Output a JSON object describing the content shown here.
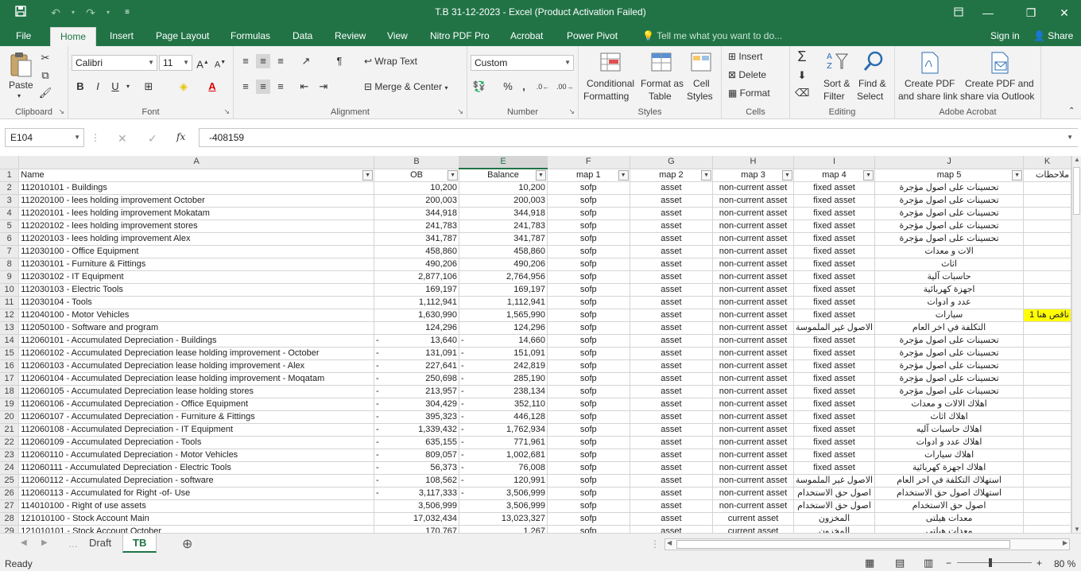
{
  "window": {
    "title": "T.B 31-12-2023 - Excel (Product Activation Failed)"
  },
  "ribbon_tabs": [
    "File",
    "Home",
    "Insert",
    "Page Layout",
    "Formulas",
    "Data",
    "Review",
    "View",
    "Nitro PDF Pro",
    "Acrobat",
    "Power Pivot"
  ],
  "tell_me": "Tell me what you want to do...",
  "account": {
    "signin": "Sign in",
    "share": "Share"
  },
  "ribbon": {
    "clipboard": {
      "paste": "Paste",
      "label": "Clipboard"
    },
    "font": {
      "name": "Calibri",
      "size": "11",
      "label": "Font",
      "bold": "B",
      "italic": "I",
      "underline": "U"
    },
    "alignment": {
      "wrap": "Wrap Text",
      "merge": "Merge & Center",
      "label": "Alignment"
    },
    "number": {
      "format": "Custom",
      "label": "Number"
    },
    "styles": {
      "conditional_1": "Conditional",
      "conditional_2": "Formatting",
      "format_table_1": "Format as",
      "format_table_2": "Table",
      "cell_styles_1": "Cell",
      "cell_styles_2": "Styles",
      "label": "Styles"
    },
    "cells": {
      "insert": "Insert",
      "delete": "Delete",
      "format": "Format",
      "label": "Cells"
    },
    "editing": {
      "sort_1": "Sort &",
      "sort_2": "Filter",
      "find_1": "Find &",
      "find_2": "Select",
      "label": "Editing"
    },
    "acrobat": {
      "create_1": "Create PDF",
      "create_2": "and share link",
      "outlook_1": "Create PDF and",
      "outlook_2": "share via Outlook",
      "label": "Adobe Acrobat"
    }
  },
  "formula_bar": {
    "name_box": "E104",
    "fx": "fx",
    "value": "-408159"
  },
  "columns": [
    "A",
    "B",
    "E",
    "F",
    "G",
    "H",
    "I",
    "J",
    "K"
  ],
  "headers": [
    "Name",
    "OB",
    "Balance",
    "map 1",
    "map 2",
    "map 3",
    "map 4",
    "map 5",
    "ملاحظات"
  ],
  "rows": [
    {
      "n": "2",
      "name": "112010101 - Buildings",
      "ob": "10,200",
      "bal": "10,200",
      "m1": "sofp",
      "m2": "asset",
      "m3": "non-current asset",
      "m4": "fixed asset",
      "m5": "تحسينات على اصول مؤجرة",
      "note": ""
    },
    {
      "n": "3",
      "name": "112020100 - lees holding improvement October",
      "ob": "200,003",
      "bal": "200,003",
      "m1": "sofp",
      "m2": "asset",
      "m3": "non-current asset",
      "m4": "fixed asset",
      "m5": "تحسينات على اصول مؤجرة",
      "note": ""
    },
    {
      "n": "4",
      "name": "112020101 - lees holding improvement Mokatam",
      "ob": "344,918",
      "bal": "344,918",
      "m1": "sofp",
      "m2": "asset",
      "m3": "non-current asset",
      "m4": "fixed asset",
      "m5": "تحسينات على اصول مؤجرة",
      "note": ""
    },
    {
      "n": "5",
      "name": "112020102 - lees holding improvement stores",
      "ob": "241,783",
      "bal": "241,783",
      "m1": "sofp",
      "m2": "asset",
      "m3": "non-current asset",
      "m4": "fixed asset",
      "m5": "تحسينات على اصول مؤجرة",
      "note": ""
    },
    {
      "n": "6",
      "name": "112020103 - lees holding improvement Alex",
      "ob": "341,787",
      "bal": "341,787",
      "m1": "sofp",
      "m2": "asset",
      "m3": "non-current asset",
      "m4": "fixed asset",
      "m5": "تحسينات على اصول مؤجرة",
      "note": ""
    },
    {
      "n": "7",
      "name": "112030100 - Office Equipment",
      "ob": "458,860",
      "bal": "458,860",
      "m1": "sofp",
      "m2": "asset",
      "m3": "non-current asset",
      "m4": "fixed asset",
      "m5": "الات و معدات",
      "note": ""
    },
    {
      "n": "8",
      "name": "112030101 - Furniture & Fittings",
      "ob": "490,206",
      "bal": "490,206",
      "m1": "sofp",
      "m2": "asset",
      "m3": "non-current asset",
      "m4": "fixed asset",
      "m5": "اثاث",
      "note": ""
    },
    {
      "n": "9",
      "name": "112030102 - IT Equipment",
      "ob": "2,877,106",
      "bal": "2,764,956",
      "m1": "sofp",
      "m2": "asset",
      "m3": "non-current asset",
      "m4": "fixed asset",
      "m5": "حاسبات آلية",
      "note": ""
    },
    {
      "n": "10",
      "name": "112030103 - Electric Tools",
      "ob": "169,197",
      "bal": "169,197",
      "m1": "sofp",
      "m2": "asset",
      "m3": "non-current asset",
      "m4": "fixed asset",
      "m5": "اجهزة كهربائية",
      "note": ""
    },
    {
      "n": "11",
      "name": "112030104 - Tools",
      "ob": "1,112,941",
      "bal": "1,112,941",
      "m1": "sofp",
      "m2": "asset",
      "m3": "non-current asset",
      "m4": "fixed asset",
      "m5": "عدد و ادوات",
      "note": ""
    },
    {
      "n": "12",
      "name": "112040100 - Motor Vehicles",
      "ob": "1,630,990",
      "bal": "1,565,990",
      "m1": "sofp",
      "m2": "asset",
      "m3": "non-current asset",
      "m4": "fixed asset",
      "m5": "سيارات",
      "note": "ناقص هنا 1"
    },
    {
      "n": "13",
      "name": "112050100 - Software and program",
      "ob": "124,296",
      "bal": "124,296",
      "m1": "sofp",
      "m2": "asset",
      "m3": "non-current asset",
      "m4": "الاصول غير الملموسة",
      "m5": "التكلفة في اخر العام",
      "note": ""
    },
    {
      "n": "14",
      "name": "112060101 - Accumulated Depreciation - Buildings",
      "ob": "13,640",
      "bal": "14,660",
      "neg": true,
      "m1": "sofp",
      "m2": "asset",
      "m3": "non-current asset",
      "m4": "fixed asset",
      "m5": "تحسينات على اصول مؤجرة",
      "note": ""
    },
    {
      "n": "15",
      "name": "112060102 - Accumulated Depreciation lease holding improvement - October",
      "ob": "131,091",
      "bal": "151,091",
      "neg": true,
      "m1": "sofp",
      "m2": "asset",
      "m3": "non-current asset",
      "m4": "fixed asset",
      "m5": "تحسينات على اصول مؤجرة",
      "note": ""
    },
    {
      "n": "16",
      "name": "112060103 - Accumulated Depreciation lease holding improvement - Alex",
      "ob": "227,641",
      "bal": "242,819",
      "neg": true,
      "m1": "sofp",
      "m2": "asset",
      "m3": "non-current asset",
      "m4": "fixed asset",
      "m5": "تحسينات على اصول مؤجرة",
      "note": ""
    },
    {
      "n": "17",
      "name": "112060104 - Accumulated Depreciation lease holding improvement - Moqatam",
      "ob": "250,698",
      "bal": "285,190",
      "neg": true,
      "m1": "sofp",
      "m2": "asset",
      "m3": "non-current asset",
      "m4": "fixed asset",
      "m5": "تحسينات على اصول مؤجرة",
      "note": ""
    },
    {
      "n": "18",
      "name": "112060105 - Accumulated Depreciation lease holding stores",
      "ob": "213,957",
      "bal": "238,134",
      "neg": true,
      "m1": "sofp",
      "m2": "asset",
      "m3": "non-current asset",
      "m4": "fixed asset",
      "m5": "تحسينات على اصول مؤجرة",
      "note": ""
    },
    {
      "n": "19",
      "name": "112060106 - Accumulated Depreciation - Office Equipment",
      "ob": "304,429",
      "bal": "352,110",
      "neg": true,
      "m1": "sofp",
      "m2": "asset",
      "m3": "non-current asset",
      "m4": "fixed asset",
      "m5": "اهلاك الالات و معدات",
      "note": ""
    },
    {
      "n": "20",
      "name": "112060107 - Accumulated Depreciation - Furniture & Fittings",
      "ob": "395,323",
      "bal": "446,128",
      "neg": true,
      "m1": "sofp",
      "m2": "asset",
      "m3": "non-current asset",
      "m4": "fixed asset",
      "m5": "اهلاك اثاث",
      "note": ""
    },
    {
      "n": "21",
      "name": "112060108 - Accumulated Depreciation - IT Equipment",
      "ob": "1,339,432",
      "bal": "1,762,934",
      "neg": true,
      "m1": "sofp",
      "m2": "asset",
      "m3": "non-current asset",
      "m4": "fixed asset",
      "m5": "اهلاك حاسبات آليه",
      "note": ""
    },
    {
      "n": "22",
      "name": "112060109 - Accumulated Depreciation - Tools",
      "ob": "635,155",
      "bal": "771,961",
      "neg": true,
      "m1": "sofp",
      "m2": "asset",
      "m3": "non-current asset",
      "m4": "fixed asset",
      "m5": "اهلاك عدد و ادوات",
      "note": ""
    },
    {
      "n": "23",
      "name": "112060110 - Accumulated Depreciation - Motor Vehicles",
      "ob": "809,057",
      "bal": "1,002,681",
      "neg": true,
      "m1": "sofp",
      "m2": "asset",
      "m3": "non-current asset",
      "m4": "fixed asset",
      "m5": "اهلاك سيارات",
      "note": ""
    },
    {
      "n": "24",
      "name": "112060111 - Accumulated Depreciation - Electric Tools",
      "ob": "56,373",
      "bal": "76,008",
      "neg": true,
      "m1": "sofp",
      "m2": "asset",
      "m3": "non-current asset",
      "m4": "fixed asset",
      "m5": "اهلاك اجهزة كهربائية",
      "note": ""
    },
    {
      "n": "25",
      "name": "112060112 - Accumulated Depreciation - software",
      "ob": "108,562",
      "bal": "120,991",
      "neg": true,
      "m1": "sofp",
      "m2": "asset",
      "m3": "non-current asset",
      "m4": "الاصول غير الملموسة",
      "m5": "استهلاك التكلفة في اخر العام",
      "note": ""
    },
    {
      "n": "26",
      "name": "112060113 - Accumulated for Right -of- Use",
      "ob": "3,117,333",
      "bal": "3,506,999",
      "neg": true,
      "m1": "sofp",
      "m2": "asset",
      "m3": "non-current asset",
      "m4": "اصول حق الاستخدام",
      "m5": "استهلاك اصول حق الاستخدام",
      "note": ""
    },
    {
      "n": "27",
      "name": "114010100 - Right of use assets",
      "ob": "3,506,999",
      "bal": "3,506,999",
      "m1": "sofp",
      "m2": "asset",
      "m3": "non-current asset",
      "m4": "اصول حق الاستخدام",
      "m5": "اصول حق الاستخدام",
      "note": ""
    },
    {
      "n": "28",
      "name": "121010100 - Stock Account Main",
      "ob": "17,032,434",
      "bal": "13,023,327",
      "m1": "sofp",
      "m2": "asset",
      "m3": "current asset",
      "m4": "المخزون",
      "m5": "معدات هيلتى",
      "note": ""
    },
    {
      "n": "29",
      "name": "121010101 - Stock Account October",
      "ob": "170,767",
      "bal": "1,267",
      "m1": "sofp",
      "m2": "asset",
      "m3": "current asset",
      "m4": "المخزون",
      "m5": "معدات هيلتى",
      "note": ""
    }
  ],
  "sheet_tabs": [
    "Draft",
    "TB"
  ],
  "status": {
    "ready": "Ready",
    "zoom": "80 %"
  },
  "colors": {
    "excel_green": "#217346",
    "note_yellow": "#ffff00"
  }
}
